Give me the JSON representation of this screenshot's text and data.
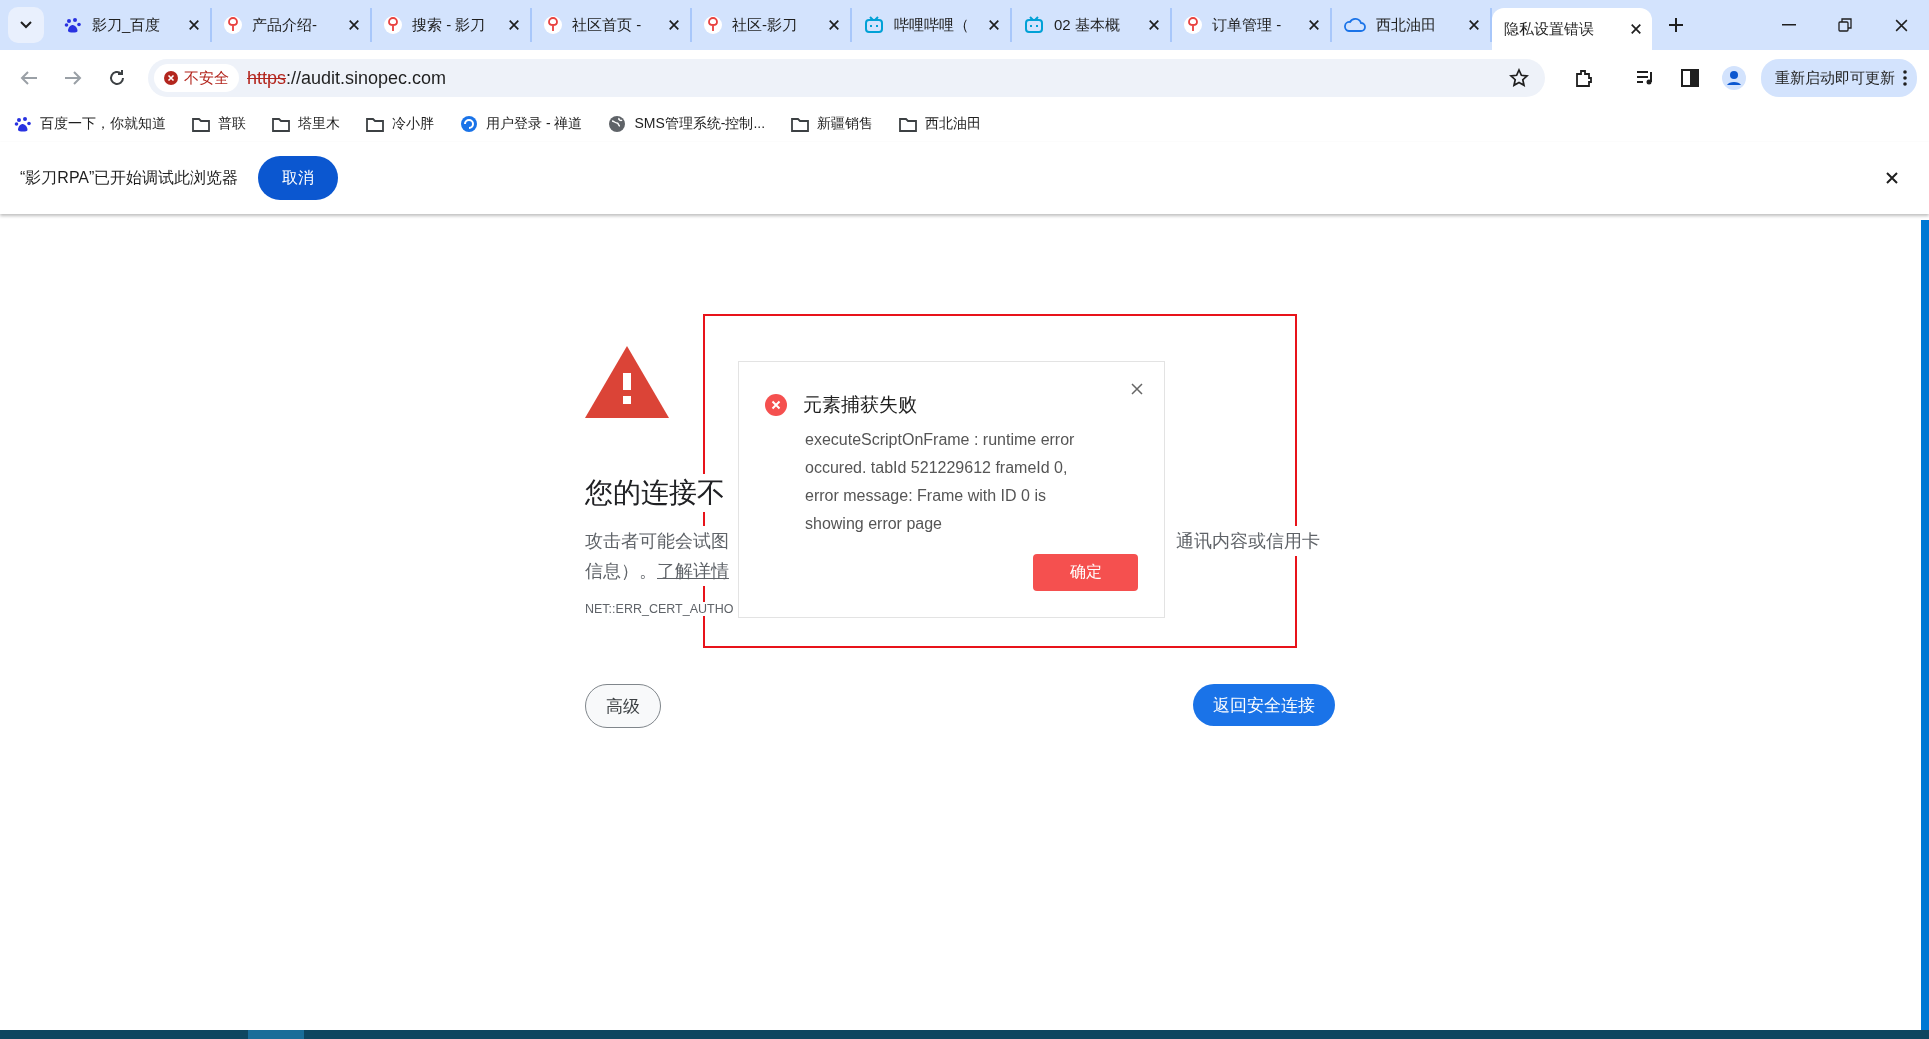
{
  "tab_strip": {
    "tabs": [
      {
        "label": "影刀_百度",
        "kind": "baidu",
        "selected": false
      },
      {
        "label": "产品介绍-",
        "kind": "pin",
        "selected": false
      },
      {
        "label": "搜索 - 影刀",
        "kind": "pin",
        "selected": false
      },
      {
        "label": "社区首页 -",
        "kind": "pin",
        "selected": false
      },
      {
        "label": "社区-影刀",
        "kind": "pin",
        "selected": false
      },
      {
        "label": "哔哩哔哩（",
        "kind": "tv",
        "selected": false
      },
      {
        "label": "02 基本概",
        "kind": "tv",
        "selected": false
      },
      {
        "label": "订单管理 -",
        "kind": "pin",
        "selected": false
      },
      {
        "label": "西北油田",
        "kind": "cloud",
        "selected": false
      },
      {
        "label": "隐私设置错误",
        "kind": "plain",
        "selected": true
      }
    ]
  },
  "toolbar": {
    "security_chip": "不安全",
    "url": {
      "scheme": "https",
      "rest": "://audit.sinopec.com"
    },
    "update_button": "重新启动即可更新"
  },
  "bookmarks": [
    {
      "label": "百度一下，你就知道",
      "kind": "baidu"
    },
    {
      "label": "普联",
      "kind": "folder"
    },
    {
      "label": "塔里木",
      "kind": "folder"
    },
    {
      "label": "冷小胖",
      "kind": "folder"
    },
    {
      "label": "用户登录 - 禅道",
      "kind": "swirl"
    },
    {
      "label": "SMS管理系统-控制...",
      "kind": "globe"
    },
    {
      "label": "新疆销售",
      "kind": "folder"
    },
    {
      "label": "西北油田",
      "kind": "folder"
    }
  ],
  "info_bar": {
    "message": "“影刀RPA”已开始调试此浏览器",
    "button": "取消"
  },
  "error_page": {
    "heading": "您的连接不",
    "description_left": "攻击者可能会试图",
    "description_right": "通讯内容或信用卡",
    "description_line2": "信息）。",
    "learn_more_link": "了解详情",
    "error_code": "NET::ERR_CERT_AUTHO",
    "advanced_button": "高级",
    "back_button": "返回安全连接"
  },
  "dialog": {
    "title": "元素捕获失败",
    "message": "executeScriptOnFrame : runtime error occured. tabId 521229612 frameId 0, error message: Frame with ID 0 is showing error page",
    "confirm_button": "确定"
  }
}
